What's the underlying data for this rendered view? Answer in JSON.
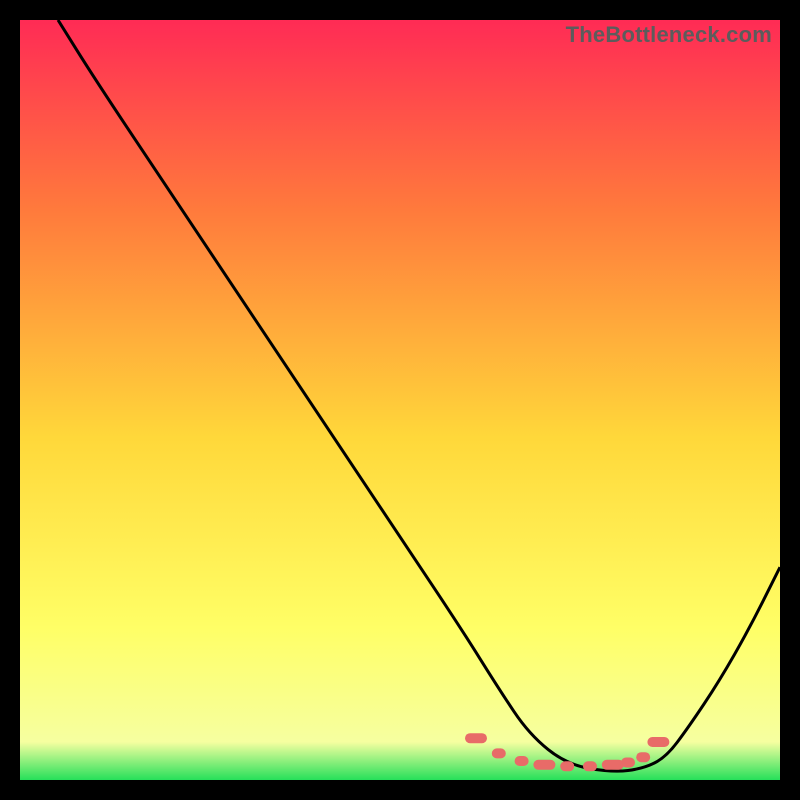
{
  "watermark": "TheBottleneck.com",
  "chart_data": {
    "type": "line",
    "title": "",
    "xlabel": "",
    "ylabel": "",
    "xlim": [
      0,
      100
    ],
    "ylim": [
      0,
      100
    ],
    "gradient_stops": [
      {
        "offset": 0,
        "color": "#ff2b55"
      },
      {
        "offset": 25,
        "color": "#ff7a3c"
      },
      {
        "offset": 55,
        "color": "#ffd83a"
      },
      {
        "offset": 80,
        "color": "#ffff66"
      },
      {
        "offset": 95,
        "color": "#f6ffa0"
      },
      {
        "offset": 100,
        "color": "#26e05a"
      }
    ],
    "series": [
      {
        "name": "bottleneck-curve",
        "color": "#000000",
        "x": [
          5,
          10,
          20,
          30,
          40,
          50,
          58,
          63,
          67,
          72,
          78,
          82,
          85,
          88,
          92,
          96,
          100
        ],
        "y": [
          100,
          92,
          77,
          62,
          47,
          32,
          20,
          12,
          6,
          2,
          1,
          1.5,
          3,
          7,
          13,
          20,
          28
        ]
      }
    ],
    "markers": {
      "name": "highlight-band",
      "color": "#e86b68",
      "x": [
        60,
        63,
        66,
        69,
        72,
        75,
        78,
        80,
        82,
        84
      ],
      "y": [
        5.5,
        3.5,
        2.5,
        2,
        1.8,
        1.8,
        2,
        2.3,
        3,
        5
      ]
    }
  }
}
